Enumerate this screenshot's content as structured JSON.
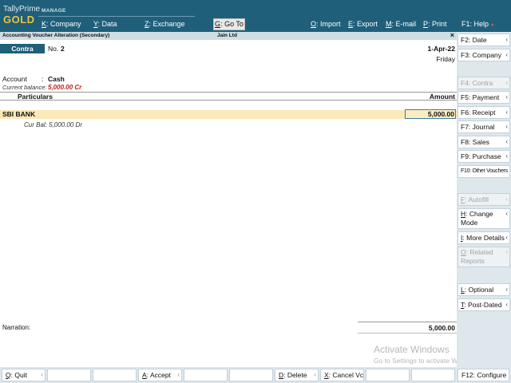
{
  "brand": {
    "product": "TallyPrime",
    "edition": "GOLD",
    "manage": "MANAGE"
  },
  "menu": {
    "company": {
      "key": "K",
      "label": "Company"
    },
    "data": {
      "key": "Y",
      "label": "Data"
    },
    "exchange": {
      "key": "Z",
      "label": "Exchange"
    },
    "goto": {
      "key": "G",
      "label": "Go To"
    },
    "import": {
      "key": "O",
      "label": "Import"
    },
    "export": {
      "key": "E",
      "label": "Export"
    },
    "email": {
      "key": "M",
      "label": "E-mail"
    },
    "print": {
      "key": "P",
      "label": "Print"
    },
    "help": {
      "key": "F1",
      "label": "Help"
    }
  },
  "titlebar": {
    "screen": "Accounting Voucher Alteration (Secondary)",
    "company": "Jain Ltd",
    "close": "×"
  },
  "voucher": {
    "type": "Contra",
    "no_label": "No.",
    "no": "2",
    "date": "1-Apr-22",
    "day": "Friday",
    "account_label": "Account",
    "account_colon": ":",
    "account": "Cash",
    "current_balance_label": "Current balance:",
    "current_balance": "5,000.00 Cr",
    "col_particulars": "Particulars",
    "col_amount": "Amount",
    "entries": [
      {
        "name": "SBI BANK",
        "amount": "5,000.00",
        "cur_bal": "Cur Bal:  5,000.00 Dr"
      }
    ],
    "narration_label": "Narration:",
    "total": "5,000.00"
  },
  "watermark": {
    "line1": "Activate Windows",
    "line2": "Go to Settings to activate Windows."
  },
  "right_panel": [
    {
      "key": "F2",
      "label": "Date"
    },
    {
      "key": "F3",
      "label": "Company"
    },
    {
      "key": "F4",
      "label": "Contra"
    },
    {
      "key": "F5",
      "label": "Payment"
    },
    {
      "key": "F6",
      "label": "Receipt"
    },
    {
      "key": "F7",
      "label": "Journal"
    },
    {
      "key": "F8",
      "label": "Sales"
    },
    {
      "key": "F9",
      "label": "Purchase"
    },
    {
      "key": "F10",
      "label": "Other Vouchers"
    },
    {
      "key": "F",
      "label": "Autofill"
    },
    {
      "key": "H",
      "label": "Change Mode"
    },
    {
      "key": "I",
      "label": "More Details"
    },
    {
      "key": "O",
      "label": "Related Reports"
    },
    {
      "key": "L",
      "label": "Optional"
    },
    {
      "key": "T",
      "label": "Post-Dated"
    }
  ],
  "bottom_bar": {
    "quit": {
      "key": "Q",
      "label": "Quit"
    },
    "accept": {
      "key": "A",
      "label": "Accept"
    },
    "delete": {
      "key": "D",
      "label": "Delete"
    },
    "cancel": {
      "key": "X",
      "label": "Cancel Vch"
    },
    "configure": {
      "key": "F12",
      "label": "Configure"
    }
  },
  "colors": {
    "header_bg": "#1f5f7a",
    "gold": "#f0c23a",
    "highlight_row": "#fbe9b7",
    "balance_red": "#c0201a"
  }
}
